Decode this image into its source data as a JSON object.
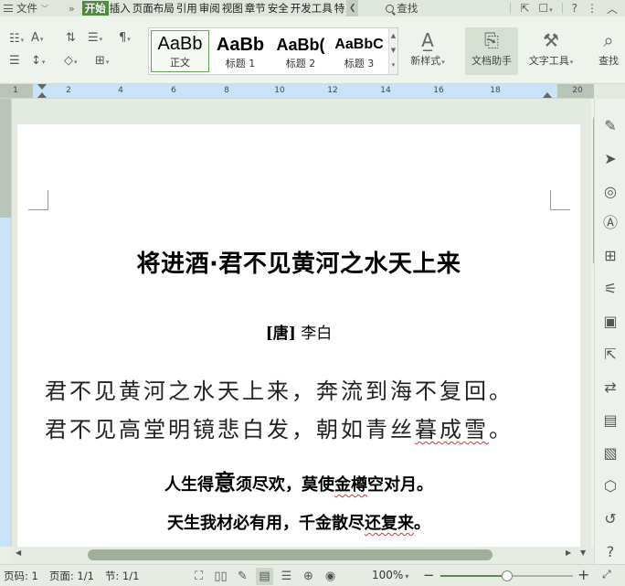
{
  "menubar": {
    "file_label": "文件",
    "tabs": [
      "开始",
      "插入",
      "页面布局",
      "引用",
      "审阅",
      "视图",
      "章节",
      "安全",
      "开发工具",
      "特"
    ],
    "active_tab": "开始",
    "search_label": "查找",
    "more_symbol": "»",
    "help_symbol": "?"
  },
  "ribbon": {
    "styles": [
      {
        "preview": "AaBb",
        "caption": "正文"
      },
      {
        "preview": "AaBb",
        "caption": "标题 1"
      },
      {
        "preview": "AaBb(",
        "caption": "标题 2"
      },
      {
        "preview": "AaBbC",
        "caption": "标题 3"
      }
    ],
    "new_style_label": "新样式",
    "doc_assistant_label": "文档助手",
    "text_tools_label": "文字工具",
    "find_replace_label": "查找"
  },
  "ruler": {
    "numbers": [
      "1",
      "2",
      "4",
      "6",
      "8",
      "10",
      "12",
      "14",
      "16",
      "18",
      "20"
    ]
  },
  "document": {
    "title": "将进酒·君不见黄河之水天上来",
    "author_dynasty": "[唐]",
    "author_name": "李白",
    "verse_line1": "君不见黄河之水天上来，奔流到海不复回。",
    "verse_line2_a": "君不见高堂明镜悲白发，朝如青丝",
    "verse_line2_b": "暮成雪",
    "verse_line2_c": "。",
    "bold_line1_a": "人生得",
    "bold_line1_big": "意",
    "bold_line1_b": "须尽欢，莫使",
    "bold_line1_c": "金樽",
    "bold_line1_d": "空对月。",
    "bold_line2_a": "天生我材必有用，千金散尽",
    "bold_line2_b": "还复来",
    "bold_line2_c": "。"
  },
  "statusbar": {
    "page_num": "页码: 1",
    "page_count": "页面: 1/1",
    "section": "节: 1/1",
    "zoom": "100%",
    "zoom_value": 0.5
  },
  "colors": {
    "accent": "#4f8a3f",
    "scroll_thumb": "#9eb09a"
  }
}
